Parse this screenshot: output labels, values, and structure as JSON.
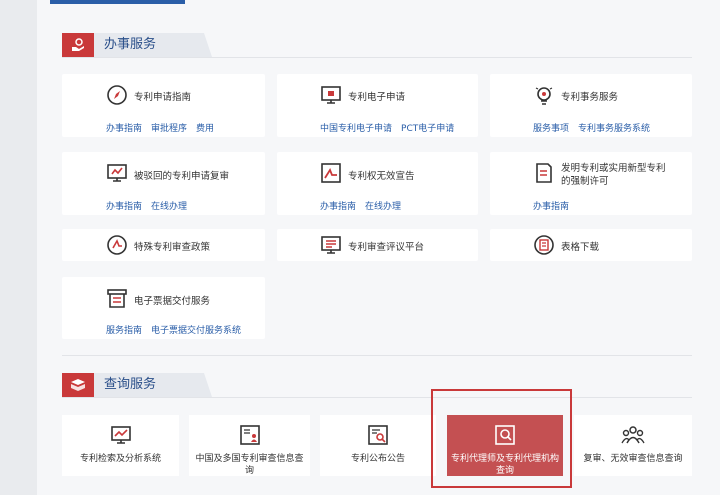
{
  "section1": {
    "title": "办事服务",
    "cards": [
      {
        "title": "专利申请指南",
        "icon": "compass-icon",
        "links": [
          "办事指南",
          "审批程序",
          "费用"
        ]
      },
      {
        "title": "专利电子申请",
        "icon": "monitor-icon",
        "links": [
          "中国专利电子申请",
          "PCT电子申请"
        ]
      },
      {
        "title": "专利事务服务",
        "icon": "bulb-icon",
        "links": [
          "服务事项",
          "专利事务服务系统"
        ]
      },
      {
        "title": "被驳回的专利申请复审",
        "icon": "screen-icon",
        "links": [
          "办事指南",
          "在线办理"
        ]
      },
      {
        "title": "专利权无效宣告",
        "icon": "chart-line-icon",
        "links": [
          "办事指南",
          "在线办理"
        ]
      },
      {
        "title": "发明专利或实用新型专利的强制许可",
        "icon": "document-icon",
        "links": [
          "办事指南"
        ]
      },
      {
        "title": "特殊专利审查政策",
        "icon": "policy-icon",
        "links": []
      },
      {
        "title": "专利审查评议平台",
        "icon": "review-platform-icon",
        "links": []
      },
      {
        "title": "表格下载",
        "icon": "form-icon",
        "links": []
      },
      {
        "title": "电子票据交付服务",
        "icon": "receipt-icon",
        "links": [
          "服务指南",
          "电子票据交付服务系统"
        ]
      }
    ]
  },
  "section2": {
    "title": "查询服务",
    "cards": [
      {
        "label": "专利检索及分析系统",
        "icon": "analytics-icon"
      },
      {
        "label": "中国及多国专利审查信息查询",
        "icon": "person-doc-icon"
      },
      {
        "label": "专利公布公告",
        "icon": "doc-search-icon"
      },
      {
        "label": "专利代理师及专利代理机构查询",
        "icon": "agent-search-icon"
      },
      {
        "label": "复审、无效审查信息查询",
        "icon": "people-icon"
      }
    ]
  },
  "colors": {
    "accent": "#c9393a",
    "link": "#2a5ea8",
    "active_card": "#c45052"
  }
}
